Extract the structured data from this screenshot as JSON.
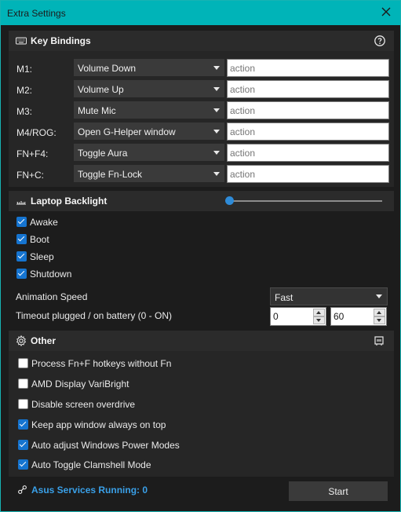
{
  "window": {
    "title": "Extra Settings",
    "accent": "#00b4b8"
  },
  "key_bindings": {
    "title": "Key Bindings",
    "rows": [
      {
        "key": "M1:",
        "selected": "Volume Down",
        "action_placeholder": "action"
      },
      {
        "key": "M2:",
        "selected": "Volume Up",
        "action_placeholder": "action"
      },
      {
        "key": "M3:",
        "selected": "Mute Mic",
        "action_placeholder": "action"
      },
      {
        "key": "M4/ROG:",
        "selected": "Open G-Helper window",
        "action_placeholder": "action"
      },
      {
        "key": "FN+F4:",
        "selected": "Toggle Aura",
        "action_placeholder": "action"
      },
      {
        "key": "FN+C:",
        "selected": "Toggle Fn-Lock",
        "action_placeholder": "action"
      }
    ]
  },
  "laptop_backlight": {
    "title": "Laptop Backlight",
    "brightness": 0,
    "checks": [
      {
        "label": "Awake",
        "checked": true
      },
      {
        "label": "Boot",
        "checked": true
      },
      {
        "label": "Sleep",
        "checked": true
      },
      {
        "label": "Shutdown",
        "checked": true
      }
    ],
    "animation_speed_label": "Animation Speed",
    "animation_speed": "Fast",
    "timeout_label": "Timeout plugged / on battery (0 - ON)",
    "timeout_plugged": "0",
    "timeout_battery": "60"
  },
  "other": {
    "title": "Other",
    "checks": [
      {
        "label": "Process Fn+F hotkeys without Fn",
        "checked": false
      },
      {
        "label": "AMD Display VariBright",
        "checked": false
      },
      {
        "label": "Disable screen overdrive",
        "checked": false
      },
      {
        "label": "Keep app window always on top",
        "checked": true
      },
      {
        "label": "Auto adjust Windows Power Modes",
        "checked": true
      },
      {
        "label": "Auto Toggle Clamshell Mode",
        "checked": true
      }
    ]
  },
  "services": {
    "status": "Asus Services Running:  0",
    "start_label": "Start",
    "status_color": "#3aa0e8"
  },
  "icons": {
    "close": "close-icon",
    "keyboard": "keyboard-icon",
    "help": "help-icon",
    "backlight": "backlight-icon",
    "gear": "gear-icon",
    "battery": "battery-icon",
    "services": "services-icon"
  }
}
